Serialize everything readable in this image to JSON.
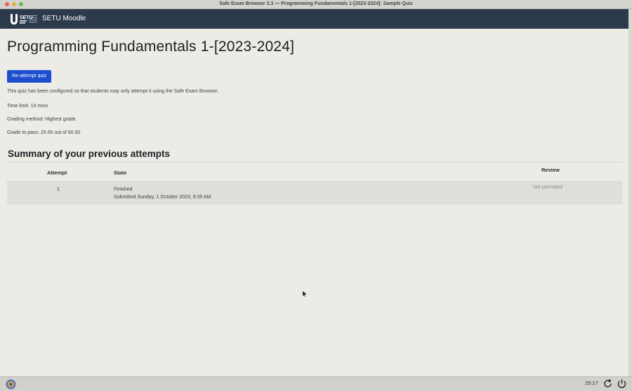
{
  "window": {
    "title": "Safe Exam Browser 3.3  —  Programming Fundamentals 1-[2023-2024]: Sample Quiz"
  },
  "navbar": {
    "site_name": "SETU Moodle",
    "logo_text": "SETU"
  },
  "page": {
    "title": "Programming Fundamentals 1-[2023-2024]",
    "reattempt_label": "Re-attempt quiz",
    "info": [
      "This quiz has been configured so that students may only attempt it using the Safe Exam Browser.",
      "Time limit: 10 mins",
      "Grading method: Highest grade",
      "Grade to pass: 25.00 out of 60.00"
    ]
  },
  "summary": {
    "heading": "Summary of your previous attempts",
    "columns": {
      "attempt": "Attempt",
      "state": "State",
      "review": "Review"
    },
    "rows": [
      {
        "attempt": "1",
        "state": "Finished",
        "submitted": "Submitted Sunday, 1 October 2023, 6:35 AM",
        "review": "Not permitted"
      }
    ]
  },
  "taskbar": {
    "time": "15:17"
  },
  "colors": {
    "navbar": "#2d3a4b",
    "primary_button": "#1d4ed0",
    "page_bg": "#ecebe6"
  }
}
